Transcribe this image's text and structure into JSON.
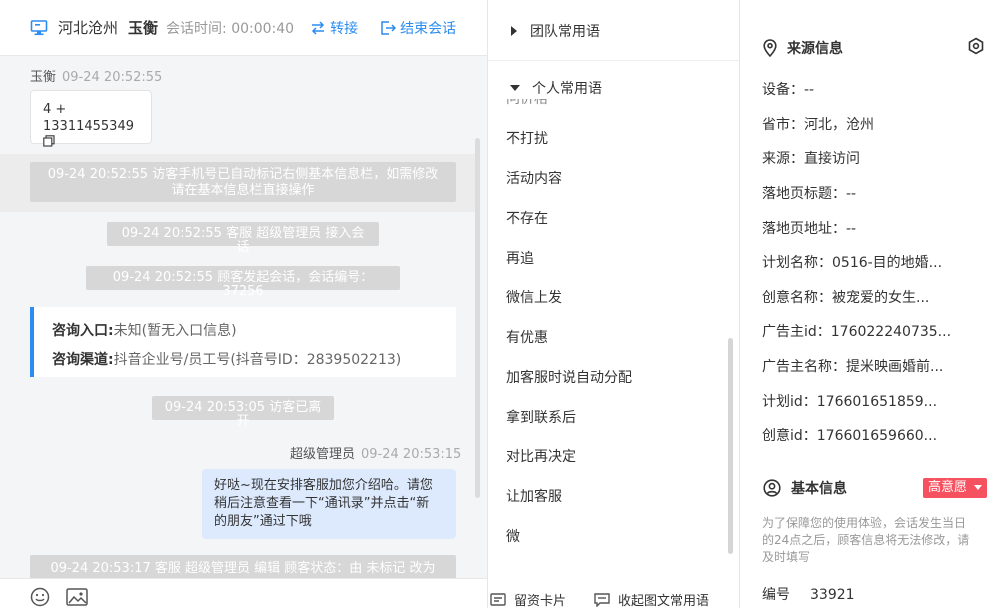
{
  "header": {
    "location": "河北沧州",
    "visitor_name": "玉衡",
    "timer_label": "会话时间:",
    "timer_value": "00:00:40",
    "transfer_label": "转接",
    "end_label": "结束会话"
  },
  "chat": {
    "visitor_msg": {
      "sender": "玉衡",
      "time": "09-24 20:52:55",
      "line1": "4 +",
      "line2": "13311455349"
    },
    "system_msgs": [
      {
        "line1": "09-24 20:52:55 访客手机号已自动标记右侧基本信息栏，如需修改",
        "line2": "请在基本信息栏直接操作"
      },
      {
        "line1": "09-24 20:52:55 客服 超级管理员 接入会话"
      },
      {
        "line1": "09-24 20:52:55 顾客发起会话，会话编号：37256"
      },
      {
        "line1": "09-24 20:53:05 访客已离开"
      },
      {
        "line1": "09-24 20:53:17 客服 超级管理员 编辑 顾客状态：由 未标记 改为"
      }
    ],
    "inquiry": {
      "entry_label": "咨询入口:",
      "entry_value": "未知(暂无入口信息)",
      "channel_label": "咨询渠道:",
      "channel_value": "抖音企业号/员工号(抖音号ID：2839502213)"
    },
    "agent_msg": {
      "sender": "超级管理员",
      "time": "09-24 20:53:15",
      "line1": "好哒~现在安排客服加您介绍哈。请您",
      "line2": "稍后注意查看一下“通讯录”并点击“新",
      "line3": "的朋友”通过下哦"
    }
  },
  "phrases": {
    "team_group": "团队常用语",
    "personal_group": "个人常用语",
    "partial_item": "问价格",
    "items": [
      "不打扰",
      "活动内容",
      "不存在",
      "再追",
      "微信上发",
      "有优惠",
      "加客服时说自动分配",
      "拿到联系后",
      "对比再决定",
      "让加客服",
      "微"
    ],
    "footer_card": "留资卡片",
    "footer_collapse": "收起图文常用语"
  },
  "source_info": {
    "title": "来源信息",
    "rows": [
      "设备：--",
      "省市：河北，沧州",
      "来源：直接访问",
      "落地页标题：--",
      "落地页地址：--",
      "计划名称：0516-目的地婚...",
      "创意名称：被宠爱的女生...",
      "广告主id：176022240735...",
      "广告主名称：提米映画婚前...",
      "计划id：176601651859...",
      "创意id：176601659660..."
    ]
  },
  "basic_info": {
    "title": "基本信息",
    "intent_badge": "高意愿",
    "note_line1": "为了保障您的使用体验，会话发生当日",
    "note_line2": "的24点之后，顾客信息将无法修改，请",
    "note_line3": "及时填写",
    "id_label": "编号",
    "id_value": "33921"
  },
  "colors": {
    "accent": "#2d8cf0",
    "badge": "#f5515f",
    "system_bg": "#d7d7d7",
    "agent_bubble": "#ddeafe"
  }
}
